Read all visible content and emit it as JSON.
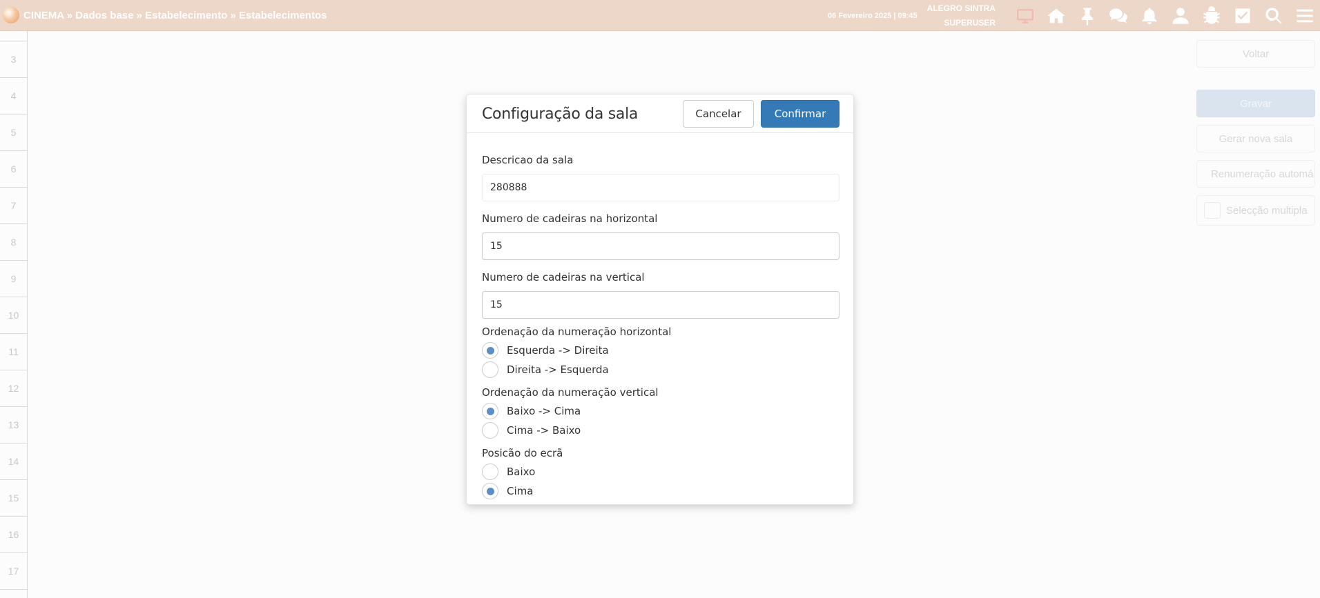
{
  "topbar": {
    "breadcrumb": "CINEMA » Dados base » Estabelecimento » Estabelecimentos",
    "datetime": "06 Fevereiro 2025 | 09:45",
    "user_name": "ALEGRO SINTRA",
    "user_role": "SUPERUSER",
    "icons": [
      "monitor-icon",
      "home-icon",
      "pin-icon",
      "chat-icon",
      "bell-icon",
      "user-icon",
      "bug-icon",
      "checkbox-icon",
      "search-icon",
      "menu-icon"
    ]
  },
  "row_numbers": [
    "",
    "3",
    "4",
    "5",
    "6",
    "7",
    "8",
    "9",
    "10",
    "11",
    "12",
    "13",
    "14",
    "15",
    "16",
    "17"
  ],
  "side_panel": {
    "back": "Voltar",
    "save": "Gravar",
    "new_room": "Gerar nova sala",
    "renumber": "Renumeração automá",
    "multi_select": "Selecção multipla"
  },
  "modal": {
    "title": "Configuração da sala",
    "cancel": "Cancelar",
    "confirm": "Confirmar",
    "description_label": "Descricao da sala",
    "description_value": "280888",
    "horizontal_label": "Numero de cadeiras na horizontal",
    "horizontal_value": "15",
    "vertical_label": "Numero de cadeiras na vertical",
    "vertical_value": "15",
    "h_order_label": "Ordenação da numeração horizontal",
    "h_order_options": [
      {
        "label": "Esquerda -> Direita",
        "checked": true
      },
      {
        "label": "Direita -> Esquerda",
        "checked": false
      }
    ],
    "v_order_label": "Ordenação da numeração vertical",
    "v_order_options": [
      {
        "label": "Baixo -> Cima",
        "checked": true
      },
      {
        "label": "Cima -> Baixo",
        "checked": false
      }
    ],
    "screen_label": "Posicão do ecrã",
    "screen_options": [
      {
        "label": "Baixo",
        "checked": false
      },
      {
        "label": "Cima",
        "checked": true
      }
    ]
  },
  "colors": {
    "topbar": "#ecd7c9",
    "primary": "#337ab7",
    "radio_checked": "#5a8ecb"
  }
}
